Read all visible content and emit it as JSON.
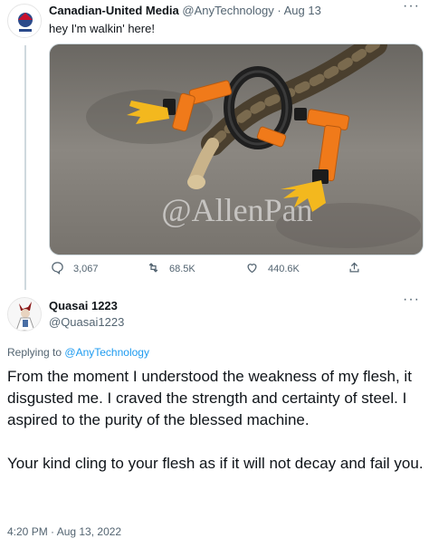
{
  "tweet1": {
    "display_name": "Canadian-United Media",
    "handle": "@AnyTechnology",
    "separator": "·",
    "date": "Aug 13",
    "text": "hey I'm walkin' here!",
    "watermark": "@AllenPan",
    "stats": {
      "replies": "3,067",
      "retweets": "68.5K",
      "likes": "440.6K"
    }
  },
  "tweet2": {
    "display_name": "Quasai 1223",
    "handle": "@Quasai1223",
    "replying_prefix": "Replying to",
    "replying_to": "@AnyTechnology",
    "paragraphs": [
      "From the moment I understood the weakness of my flesh, it disgusted me. I craved the strength and certainty of steel. I aspired to the purity of the blessed machine.",
      "Your kind cling to your flesh as if it will not decay and fail you."
    ],
    "timestamp": "4:20 PM · Aug 13, 2022"
  },
  "icons": [
    "reply-icon",
    "retweet-icon",
    "like-icon",
    "share-icon",
    "more-icon"
  ],
  "colors": {
    "link": "#1d9bf0",
    "muted": "#536471",
    "robot_orange": "#f07a1a"
  }
}
